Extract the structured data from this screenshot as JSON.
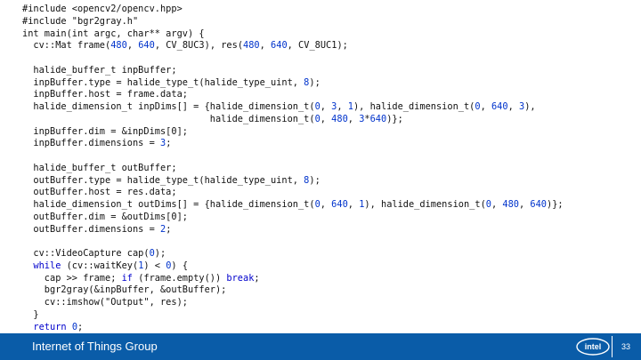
{
  "code_lines": [
    "#include <opencv2/opencv.hpp>",
    "#include \"bgr2gray.h\"",
    "int main(int argc, char** argv) {",
    "  cv::Mat frame(480, 640, CV_8UC3), res(480, 640, CV_8UC1);",
    "",
    "  halide_buffer_t inpBuffer;",
    "  inpBuffer.type = halide_type_t(halide_type_uint, 8);",
    "  inpBuffer.host = frame.data;",
    "  halide_dimension_t inpDims[] = {halide_dimension_t(0, 3, 1), halide_dimension_t(0, 640, 3),",
    "                                  halide_dimension_t(0, 480, 3*640)};",
    "  inpBuffer.dim = &inpDims[0];",
    "  inpBuffer.dimensions = 3;",
    "",
    "  halide_buffer_t outBuffer;",
    "  outBuffer.type = halide_type_t(halide_type_uint, 8);",
    "  outBuffer.host = res.data;",
    "  halide_dimension_t outDims[] = {halide_dimension_t(0, 640, 1), halide_dimension_t(0, 480, 640)};",
    "  outBuffer.dim = &outDims[0];",
    "  outBuffer.dimensions = 2;",
    "",
    "  cv::VideoCapture cap(0);",
    "  while (cv::waitKey(1) < 0) {",
    "    cap >> frame; if (frame.empty()) break;",
    "    bgr2gray(&inpBuffer, &outBuffer);",
    "    cv::imshow(\"Output\", res);",
    "  }",
    "  return 0;",
    "}"
  ],
  "footer": {
    "group_name": "Internet of Things Group",
    "logo_text": "intel",
    "page_number": "33"
  },
  "colors": {
    "footer_background": "#0a5ca8",
    "keyword": "#0000cc",
    "number": "#0033cc"
  }
}
